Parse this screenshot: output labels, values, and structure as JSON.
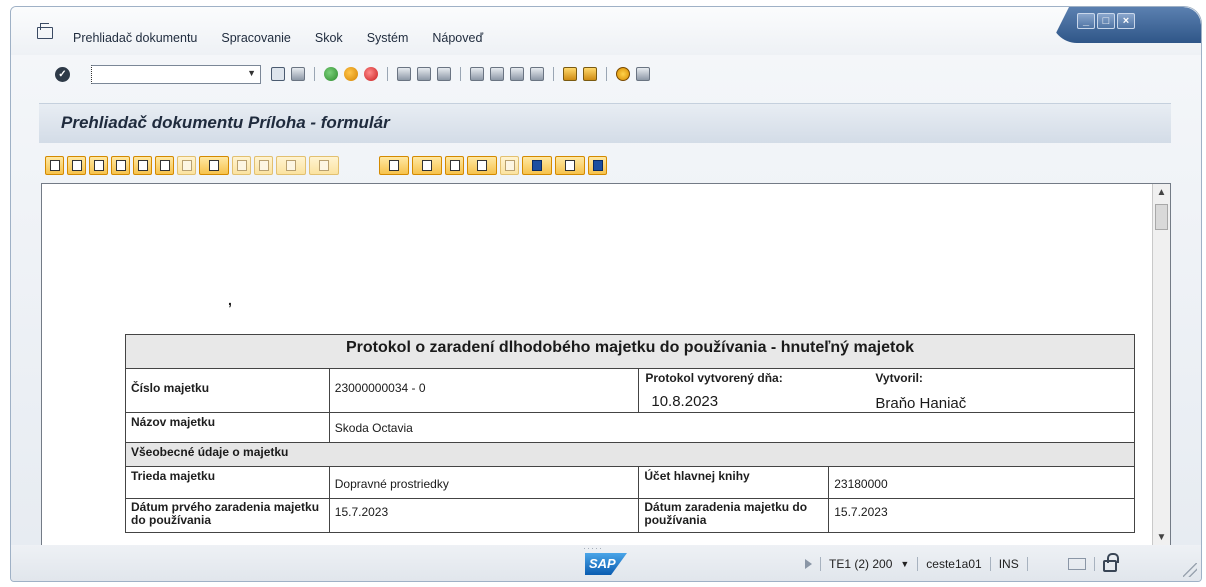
{
  "menubar": {
    "items": [
      "Prehliadač dokumentu",
      "Spracovanie",
      "Skok",
      "Systém",
      "Nápoveď"
    ]
  },
  "window_controls": {
    "minimize": "_",
    "maximize": "□",
    "close": "×"
  },
  "toolbar": {
    "command_field_value": ""
  },
  "title": "Prehliadač dokumentu Príloha - formulár",
  "document": {
    "stray_mark": ",",
    "form": {
      "heading": "Protokol o zaradení dlhodobého majetku do používania - hnuteľný majetok",
      "asset_number_label": "Číslo majetku",
      "asset_number_value": "23000000034 - 0",
      "protocol_created_label": "Protokol vytvorený dňa:",
      "protocol_created_value": "10.8.2023",
      "created_by_label": "Vytvoril:",
      "created_by_value": "Braňo Haniač",
      "asset_name_label": "Názov majetku",
      "asset_name_value": "Skoda Octavia",
      "general_section": "Všeobecné údaje o majetku",
      "asset_class_label": "Trieda majetku",
      "asset_class_value": "Dopravné prostriedky",
      "gl_account_label": "Účet hlavnej knihy",
      "gl_account_value": "23180000",
      "first_capitalization_label": "Dátum prvého zaradenia majetku do používania",
      "first_capitalization_value": "15.7.2023",
      "capitalization_label": "Dátum zaradenia majetku do používania",
      "capitalization_value": "15.7.2023"
    }
  },
  "statusbar": {
    "logo": "SAP",
    "system": "TE1 (2) 200",
    "server": "ceste1a01",
    "mode": "INS"
  },
  "colors": {
    "accent_blue": "#2f5688",
    "toolbar_yellow": "#f6c24c"
  }
}
